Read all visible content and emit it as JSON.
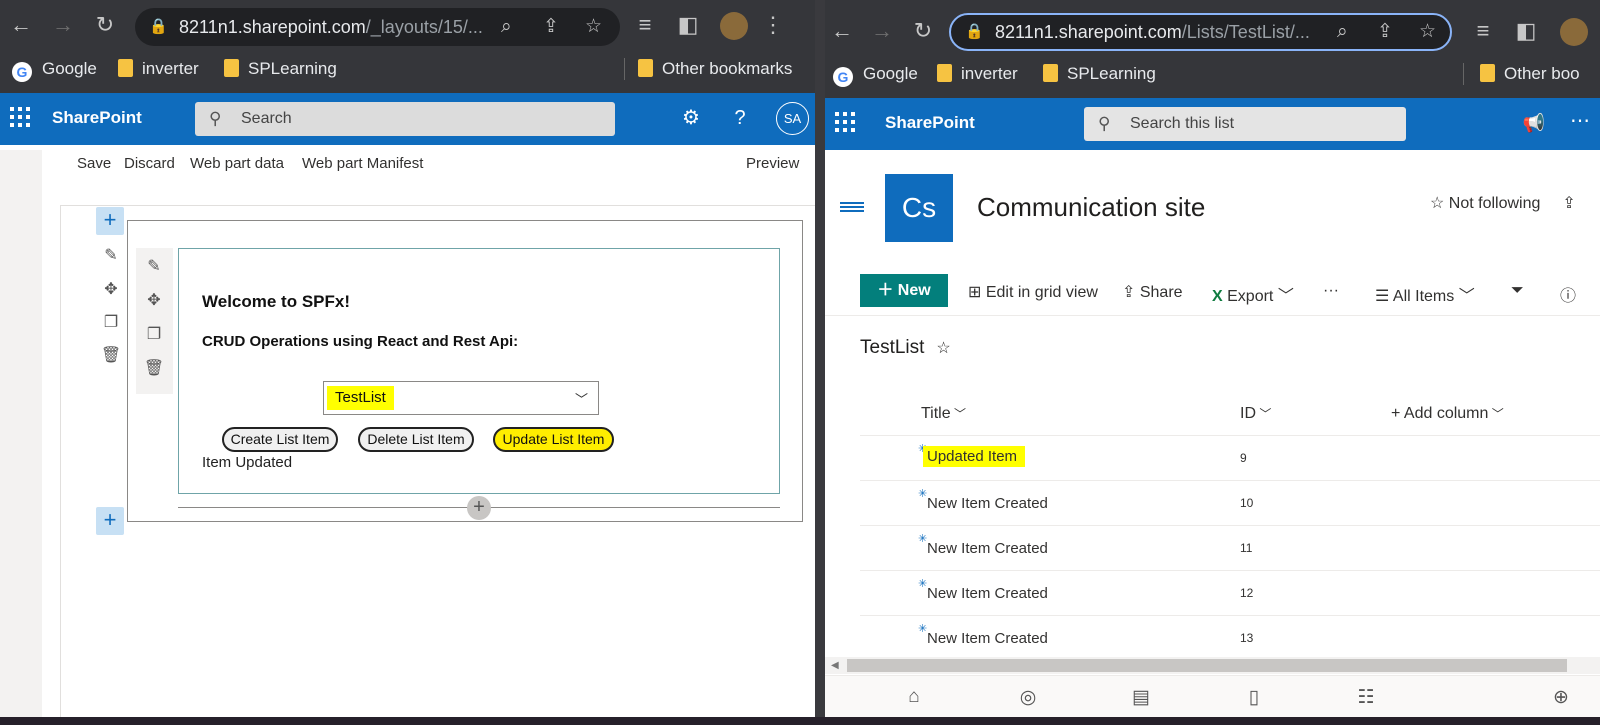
{
  "left_window": {
    "address": {
      "host": "8211n1.sharepoint.com",
      "path": "/_layouts/15/..."
    },
    "bookmarks": {
      "google": "Google",
      "inverter": "inverter",
      "splearning": "SPLearning",
      "other": "Other bookmarks"
    },
    "suite": {
      "brand": "SharePoint",
      "search_placeholder": "Search",
      "avatar": "SA",
      "help": "?"
    },
    "commands": {
      "save": "Save",
      "discard": "Discard",
      "webpart_data": "Web part data",
      "manifest": "Web part Manifest",
      "preview": "Preview"
    },
    "webpart": {
      "title": "Welcome to SPFx!",
      "subtitle": "CRUD Operations using React and Rest Api:",
      "list_selected": "TestList",
      "create": "Create List Item",
      "delete": "Delete List Item",
      "update": "Update List Item",
      "status": "Item Updated"
    }
  },
  "right_window": {
    "address": {
      "host": "8211n1.sharepoint.com",
      "path": "/Lists/TestList/..."
    },
    "bookmarks": {
      "google": "Google",
      "inverter": "inverter",
      "splearning": "SPLearning",
      "other": "Other boo"
    },
    "suite": {
      "brand": "SharePoint",
      "search_placeholder": "Search this list"
    },
    "site": {
      "logo": "Cs",
      "title": "Communication site",
      "follow": "Not following"
    },
    "listcmd": {
      "new": "New",
      "grid": "Edit in grid view",
      "share": "Share",
      "export": "Export",
      "more": "···",
      "view": "All Items"
    },
    "list_name": "TestList",
    "columns": {
      "title": "Title",
      "id": "ID",
      "add": "Add column"
    },
    "rows": [
      {
        "title": "Updated Item",
        "id": "9"
      },
      {
        "title": "New Item Created",
        "id": "10"
      },
      {
        "title": "New Item Created",
        "id": "11"
      },
      {
        "title": "New Item Created",
        "id": "12"
      },
      {
        "title": "New Item Created",
        "id": "13"
      }
    ]
  },
  "colors": {
    "suite_blue": "#0f6cbd",
    "teal": "#037f7c",
    "highlight": "#ffff00"
  }
}
